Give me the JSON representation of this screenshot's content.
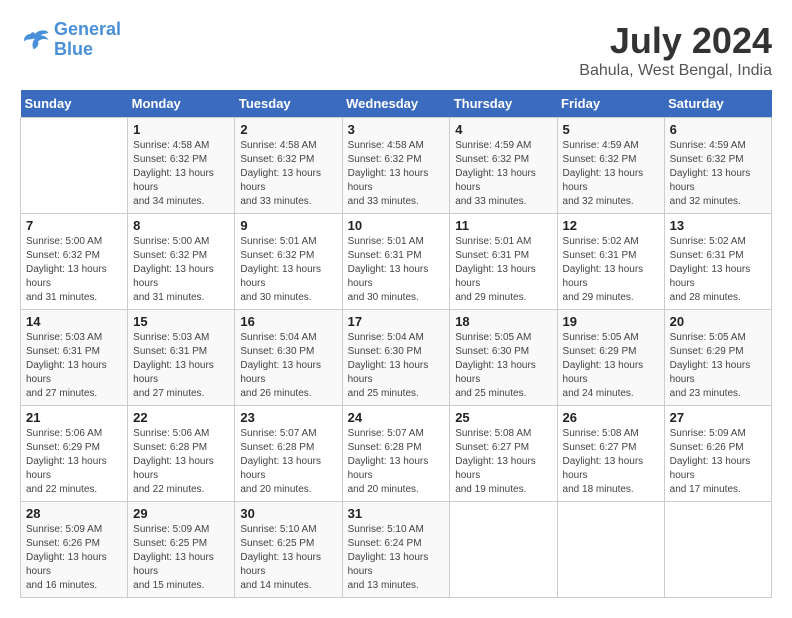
{
  "logo": {
    "line1": "General",
    "line2": "Blue"
  },
  "title": {
    "month_year": "July 2024",
    "location": "Bahula, West Bengal, India"
  },
  "days_of_week": [
    "Sunday",
    "Monday",
    "Tuesday",
    "Wednesday",
    "Thursday",
    "Friday",
    "Saturday"
  ],
  "weeks": [
    [
      {
        "day": "",
        "sunrise": "",
        "sunset": "",
        "daylight": ""
      },
      {
        "day": "1",
        "sunrise": "Sunrise: 4:58 AM",
        "sunset": "Sunset: 6:32 PM",
        "daylight": "Daylight: 13 hours and 34 minutes."
      },
      {
        "day": "2",
        "sunrise": "Sunrise: 4:58 AM",
        "sunset": "Sunset: 6:32 PM",
        "daylight": "Daylight: 13 hours and 33 minutes."
      },
      {
        "day": "3",
        "sunrise": "Sunrise: 4:58 AM",
        "sunset": "Sunset: 6:32 PM",
        "daylight": "Daylight: 13 hours and 33 minutes."
      },
      {
        "day": "4",
        "sunrise": "Sunrise: 4:59 AM",
        "sunset": "Sunset: 6:32 PM",
        "daylight": "Daylight: 13 hours and 33 minutes."
      },
      {
        "day": "5",
        "sunrise": "Sunrise: 4:59 AM",
        "sunset": "Sunset: 6:32 PM",
        "daylight": "Daylight: 13 hours and 32 minutes."
      },
      {
        "day": "6",
        "sunrise": "Sunrise: 4:59 AM",
        "sunset": "Sunset: 6:32 PM",
        "daylight": "Daylight: 13 hours and 32 minutes."
      }
    ],
    [
      {
        "day": "7",
        "sunrise": "Sunrise: 5:00 AM",
        "sunset": "Sunset: 6:32 PM",
        "daylight": "Daylight: 13 hours and 31 minutes."
      },
      {
        "day": "8",
        "sunrise": "Sunrise: 5:00 AM",
        "sunset": "Sunset: 6:32 PM",
        "daylight": "Daylight: 13 hours and 31 minutes."
      },
      {
        "day": "9",
        "sunrise": "Sunrise: 5:01 AM",
        "sunset": "Sunset: 6:32 PM",
        "daylight": "Daylight: 13 hours and 30 minutes."
      },
      {
        "day": "10",
        "sunrise": "Sunrise: 5:01 AM",
        "sunset": "Sunset: 6:31 PM",
        "daylight": "Daylight: 13 hours and 30 minutes."
      },
      {
        "day": "11",
        "sunrise": "Sunrise: 5:01 AM",
        "sunset": "Sunset: 6:31 PM",
        "daylight": "Daylight: 13 hours and 29 minutes."
      },
      {
        "day": "12",
        "sunrise": "Sunrise: 5:02 AM",
        "sunset": "Sunset: 6:31 PM",
        "daylight": "Daylight: 13 hours and 29 minutes."
      },
      {
        "day": "13",
        "sunrise": "Sunrise: 5:02 AM",
        "sunset": "Sunset: 6:31 PM",
        "daylight": "Daylight: 13 hours and 28 minutes."
      }
    ],
    [
      {
        "day": "14",
        "sunrise": "Sunrise: 5:03 AM",
        "sunset": "Sunset: 6:31 PM",
        "daylight": "Daylight: 13 hours and 27 minutes."
      },
      {
        "day": "15",
        "sunrise": "Sunrise: 5:03 AM",
        "sunset": "Sunset: 6:31 PM",
        "daylight": "Daylight: 13 hours and 27 minutes."
      },
      {
        "day": "16",
        "sunrise": "Sunrise: 5:04 AM",
        "sunset": "Sunset: 6:30 PM",
        "daylight": "Daylight: 13 hours and 26 minutes."
      },
      {
        "day": "17",
        "sunrise": "Sunrise: 5:04 AM",
        "sunset": "Sunset: 6:30 PM",
        "daylight": "Daylight: 13 hours and 25 minutes."
      },
      {
        "day": "18",
        "sunrise": "Sunrise: 5:05 AM",
        "sunset": "Sunset: 6:30 PM",
        "daylight": "Daylight: 13 hours and 25 minutes."
      },
      {
        "day": "19",
        "sunrise": "Sunrise: 5:05 AM",
        "sunset": "Sunset: 6:29 PM",
        "daylight": "Daylight: 13 hours and 24 minutes."
      },
      {
        "day": "20",
        "sunrise": "Sunrise: 5:05 AM",
        "sunset": "Sunset: 6:29 PM",
        "daylight": "Daylight: 13 hours and 23 minutes."
      }
    ],
    [
      {
        "day": "21",
        "sunrise": "Sunrise: 5:06 AM",
        "sunset": "Sunset: 6:29 PM",
        "daylight": "Daylight: 13 hours and 22 minutes."
      },
      {
        "day": "22",
        "sunrise": "Sunrise: 5:06 AM",
        "sunset": "Sunset: 6:28 PM",
        "daylight": "Daylight: 13 hours and 22 minutes."
      },
      {
        "day": "23",
        "sunrise": "Sunrise: 5:07 AM",
        "sunset": "Sunset: 6:28 PM",
        "daylight": "Daylight: 13 hours and 20 minutes."
      },
      {
        "day": "24",
        "sunrise": "Sunrise: 5:07 AM",
        "sunset": "Sunset: 6:28 PM",
        "daylight": "Daylight: 13 hours and 20 minutes."
      },
      {
        "day": "25",
        "sunrise": "Sunrise: 5:08 AM",
        "sunset": "Sunset: 6:27 PM",
        "daylight": "Daylight: 13 hours and 19 minutes."
      },
      {
        "day": "26",
        "sunrise": "Sunrise: 5:08 AM",
        "sunset": "Sunset: 6:27 PM",
        "daylight": "Daylight: 13 hours and 18 minutes."
      },
      {
        "day": "27",
        "sunrise": "Sunrise: 5:09 AM",
        "sunset": "Sunset: 6:26 PM",
        "daylight": "Daylight: 13 hours and 17 minutes."
      }
    ],
    [
      {
        "day": "28",
        "sunrise": "Sunrise: 5:09 AM",
        "sunset": "Sunset: 6:26 PM",
        "daylight": "Daylight: 13 hours and 16 minutes."
      },
      {
        "day": "29",
        "sunrise": "Sunrise: 5:09 AM",
        "sunset": "Sunset: 6:25 PM",
        "daylight": "Daylight: 13 hours and 15 minutes."
      },
      {
        "day": "30",
        "sunrise": "Sunrise: 5:10 AM",
        "sunset": "Sunset: 6:25 PM",
        "daylight": "Daylight: 13 hours and 14 minutes."
      },
      {
        "day": "31",
        "sunrise": "Sunrise: 5:10 AM",
        "sunset": "Sunset: 6:24 PM",
        "daylight": "Daylight: 13 hours and 13 minutes."
      },
      {
        "day": "",
        "sunrise": "",
        "sunset": "",
        "daylight": ""
      },
      {
        "day": "",
        "sunrise": "",
        "sunset": "",
        "daylight": ""
      },
      {
        "day": "",
        "sunrise": "",
        "sunset": "",
        "daylight": ""
      }
    ]
  ]
}
